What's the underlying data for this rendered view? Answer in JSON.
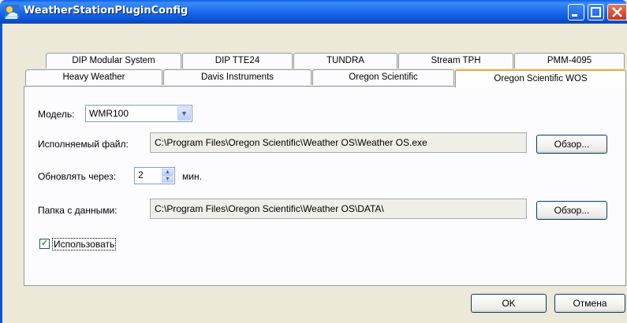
{
  "window": {
    "title": "WeatherStationPluginConfig"
  },
  "tabs_back_row": [
    "DIP Modular System",
    "DIP TTE24",
    "TUNDRA",
    "Stream TPH",
    "PMM-4095"
  ],
  "tabs_front_row": [
    "Heavy Weather",
    "Davis Instruments",
    "Oregon Scientific",
    "Oregon Scientific WOS"
  ],
  "active_tab": "Oregon Scientific WOS",
  "form": {
    "model_label": "Модель:",
    "model_value": "WMR100",
    "exe_label": "Исполняемый файл:",
    "exe_value": "C:\\Program Files\\Oregon Scientific\\Weather OS\\Weather OS.exe",
    "browse_label": "Обзор...",
    "update_label": "Обновлять через:",
    "update_value": "2",
    "update_unit": "мин.",
    "data_label": "Папка с данными:",
    "data_value": "C:\\Program Files\\Oregon Scientific\\Weather OS\\DATA\\",
    "use_label": "Использовать",
    "use_checked": true
  },
  "footer": {
    "ok_label": "OK",
    "cancel_label": "Отмена"
  },
  "colors": {
    "title_bar": "#0B55D8",
    "window_bg": "#ECE9D8",
    "active_tab_accent": "#F3A83F",
    "check_mark": "#21A121"
  }
}
